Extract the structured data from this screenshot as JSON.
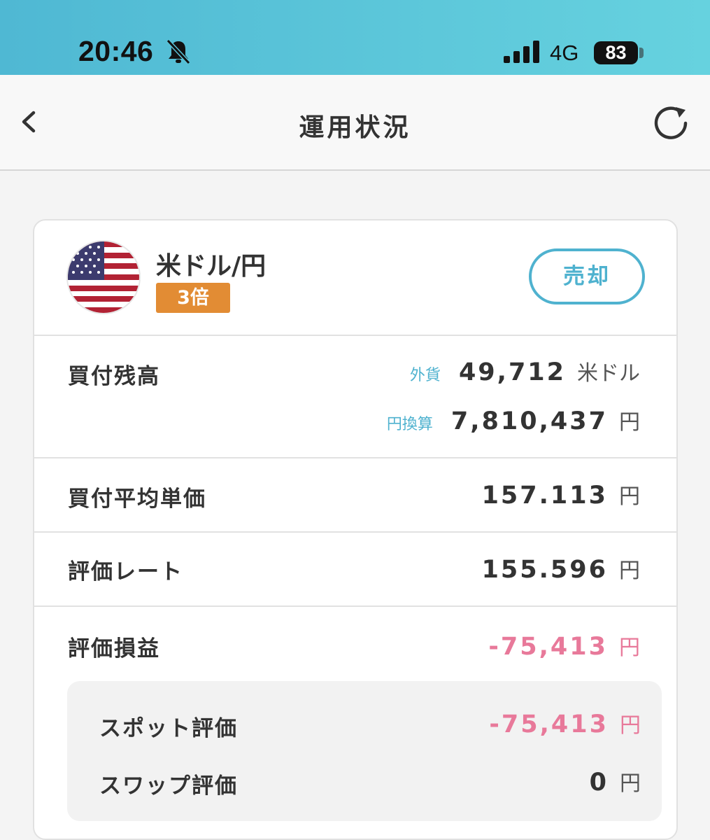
{
  "status_bar": {
    "time": "20:46",
    "network": "4G",
    "battery": "83",
    "icons": [
      "bell-slash-icon",
      "signal-icon"
    ]
  },
  "nav": {
    "title": "運用状況",
    "icons": [
      "chevron-left-icon",
      "refresh-icon"
    ]
  },
  "currency": {
    "pair": "米ドル/円",
    "leverage": "3倍",
    "flag": "us-flag-icon",
    "sell_label": "売却"
  },
  "holdings": {
    "label": "買付残高",
    "foreign_label": "外貨",
    "foreign_value": "49,712",
    "foreign_unit": "米ドル",
    "yen_label": "円換算",
    "yen_value": "7,810,437",
    "yen_unit": "円"
  },
  "avg_price": {
    "label": "買付平均単価",
    "value": "157.113",
    "unit": "円"
  },
  "rate": {
    "label": "評価レート",
    "value": "155.596",
    "unit": "円"
  },
  "pnl": {
    "label": "評価損益",
    "value": "-75,413",
    "unit": "円"
  },
  "spot": {
    "label": "スポット評価",
    "value": "-75,413",
    "unit": "円"
  },
  "swap": {
    "label": "スワップ評価",
    "value": "0",
    "unit": "円"
  },
  "colors": {
    "accent": "#4fb2cf",
    "badge": "#e28c34",
    "negative": "#e8799a",
    "header_gradient_start": "#4fb8d3",
    "header_gradient_end": "#66d2df"
  }
}
